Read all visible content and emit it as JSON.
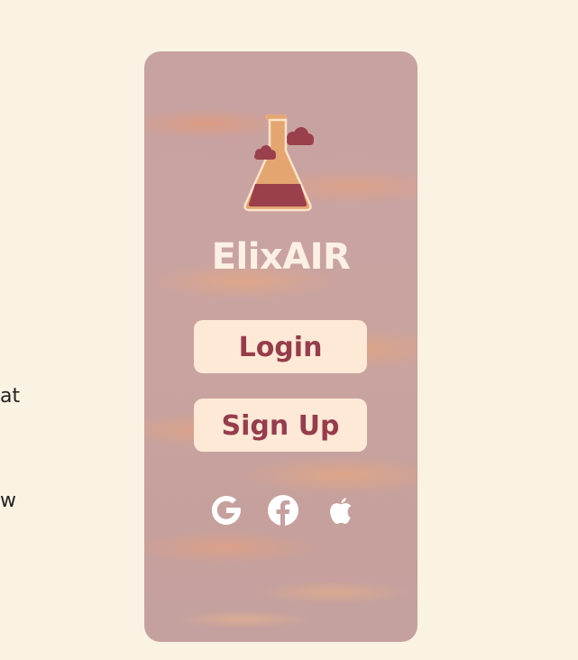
{
  "background": {
    "page_color": "#faf3e3",
    "stray_text": [
      "at",
      "w"
    ]
  },
  "card": {
    "background_colors": [
      "#c7a2a0",
      "#eea070"
    ],
    "logo_icon": "flask-clouds-icon",
    "app_title": "ElixAIR",
    "title_color": "#fbf0e3",
    "buttons": {
      "login_label": "Login",
      "signup_label": "Sign Up",
      "button_bg": "#fde9d6",
      "button_text_color": "#963c4d"
    },
    "social": [
      {
        "icon": "google-icon"
      },
      {
        "icon": "facebook-icon"
      },
      {
        "icon": "apple-icon"
      }
    ]
  }
}
